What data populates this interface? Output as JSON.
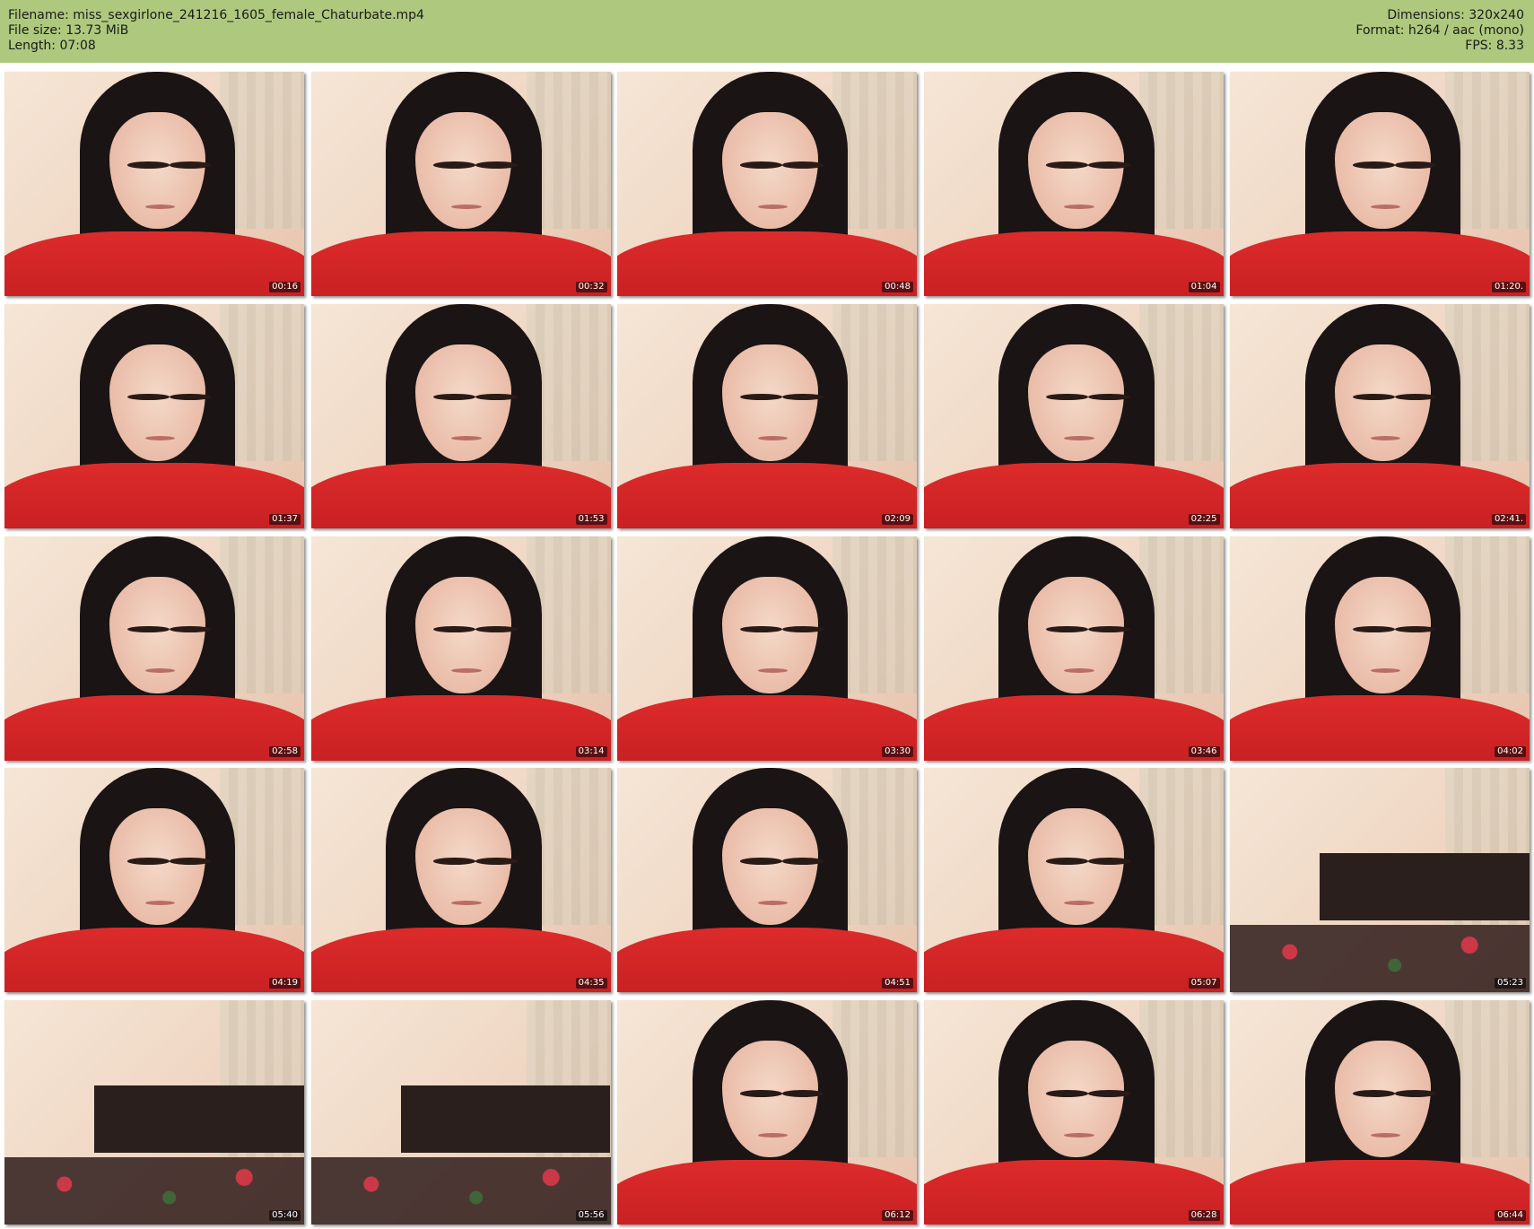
{
  "header": {
    "filename_line": "Filename: miss_sexgirlone_241216_1605_female_Chaturbate.mp4",
    "filesize_line": "File size: 13.73 MiB",
    "length_line": "Length: 07:08",
    "dimensions_line": "Dimensions: 320x240",
    "format_line": "Format: h264 / aac (mono)",
    "fps_line": "FPS: 8.33",
    "background_color": "#aec97e"
  },
  "thumbnails": [
    {
      "timestamp": "00:16"
    },
    {
      "timestamp": "00:32"
    },
    {
      "timestamp": "00:48"
    },
    {
      "timestamp": "01:04"
    },
    {
      "timestamp": "01:20."
    },
    {
      "timestamp": "01:37"
    },
    {
      "timestamp": "01:53"
    },
    {
      "timestamp": "02:09"
    },
    {
      "timestamp": "02:25"
    },
    {
      "timestamp": "02:41."
    },
    {
      "timestamp": "02:58"
    },
    {
      "timestamp": "03:14"
    },
    {
      "timestamp": "03:30"
    },
    {
      "timestamp": "03:46"
    },
    {
      "timestamp": "04:02"
    },
    {
      "timestamp": "04:19"
    },
    {
      "timestamp": "04:35"
    },
    {
      "timestamp": "04:51"
    },
    {
      "timestamp": "05:07"
    },
    {
      "timestamp": "05:23"
    },
    {
      "timestamp": "05:40"
    },
    {
      "timestamp": "05:56"
    },
    {
      "timestamp": "06:12"
    },
    {
      "timestamp": "06:28"
    },
    {
      "timestamp": "06:44"
    }
  ]
}
